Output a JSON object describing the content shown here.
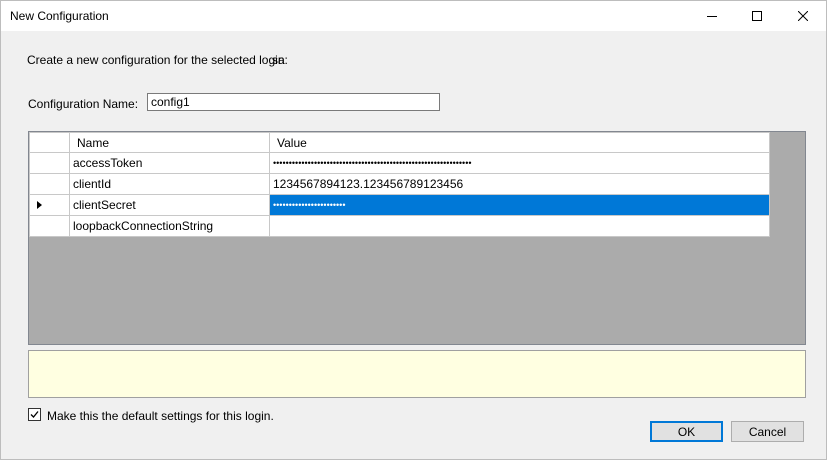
{
  "window": {
    "title": "New Configuration"
  },
  "intro": {
    "text": "Create a new configuration for the selected login:",
    "login": "sa"
  },
  "config_name": {
    "label": "Configuration Name:",
    "value": "config1"
  },
  "grid": {
    "columns": [
      "Name",
      "Value"
    ],
    "rows": [
      {
        "name": "accessToken",
        "value": "•••••••••••••••••••••••••••••••••••••••••••••••••••••••••••••••"
      },
      {
        "name": "clientId",
        "value": "1234567894123.123456789123456"
      },
      {
        "name": "clientSecret",
        "value": "•••••••••••••••••••••••"
      },
      {
        "name": "loopbackConnectionString",
        "value": ""
      }
    ],
    "selected_row": 2
  },
  "default_checkbox": {
    "label": "Make this the default settings for this login.",
    "checked": true
  },
  "buttons": {
    "ok": "OK",
    "cancel": "Cancel"
  }
}
